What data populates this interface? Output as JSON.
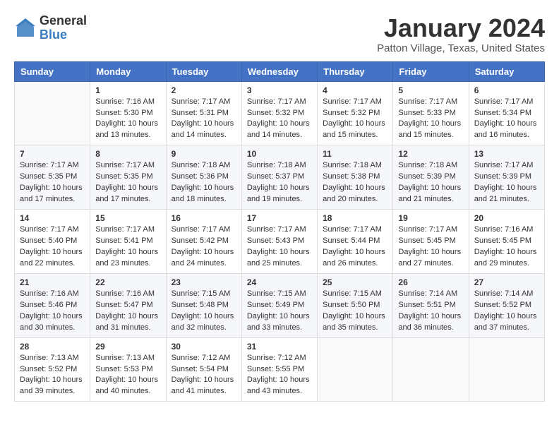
{
  "header": {
    "logo_general": "General",
    "logo_blue": "Blue",
    "month_title": "January 2024",
    "location": "Patton Village, Texas, United States"
  },
  "weekdays": [
    "Sunday",
    "Monday",
    "Tuesday",
    "Wednesday",
    "Thursday",
    "Friday",
    "Saturday"
  ],
  "weeks": [
    [
      {
        "day": "",
        "info": ""
      },
      {
        "day": "1",
        "info": "Sunrise: 7:16 AM\nSunset: 5:30 PM\nDaylight: 10 hours\nand 13 minutes."
      },
      {
        "day": "2",
        "info": "Sunrise: 7:17 AM\nSunset: 5:31 PM\nDaylight: 10 hours\nand 14 minutes."
      },
      {
        "day": "3",
        "info": "Sunrise: 7:17 AM\nSunset: 5:32 PM\nDaylight: 10 hours\nand 14 minutes."
      },
      {
        "day": "4",
        "info": "Sunrise: 7:17 AM\nSunset: 5:32 PM\nDaylight: 10 hours\nand 15 minutes."
      },
      {
        "day": "5",
        "info": "Sunrise: 7:17 AM\nSunset: 5:33 PM\nDaylight: 10 hours\nand 15 minutes."
      },
      {
        "day": "6",
        "info": "Sunrise: 7:17 AM\nSunset: 5:34 PM\nDaylight: 10 hours\nand 16 minutes."
      }
    ],
    [
      {
        "day": "7",
        "info": "Sunrise: 7:17 AM\nSunset: 5:35 PM\nDaylight: 10 hours\nand 17 minutes."
      },
      {
        "day": "8",
        "info": "Sunrise: 7:17 AM\nSunset: 5:35 PM\nDaylight: 10 hours\nand 17 minutes."
      },
      {
        "day": "9",
        "info": "Sunrise: 7:18 AM\nSunset: 5:36 PM\nDaylight: 10 hours\nand 18 minutes."
      },
      {
        "day": "10",
        "info": "Sunrise: 7:18 AM\nSunset: 5:37 PM\nDaylight: 10 hours\nand 19 minutes."
      },
      {
        "day": "11",
        "info": "Sunrise: 7:18 AM\nSunset: 5:38 PM\nDaylight: 10 hours\nand 20 minutes."
      },
      {
        "day": "12",
        "info": "Sunrise: 7:18 AM\nSunset: 5:39 PM\nDaylight: 10 hours\nand 21 minutes."
      },
      {
        "day": "13",
        "info": "Sunrise: 7:17 AM\nSunset: 5:39 PM\nDaylight: 10 hours\nand 21 minutes."
      }
    ],
    [
      {
        "day": "14",
        "info": "Sunrise: 7:17 AM\nSunset: 5:40 PM\nDaylight: 10 hours\nand 22 minutes."
      },
      {
        "day": "15",
        "info": "Sunrise: 7:17 AM\nSunset: 5:41 PM\nDaylight: 10 hours\nand 23 minutes."
      },
      {
        "day": "16",
        "info": "Sunrise: 7:17 AM\nSunset: 5:42 PM\nDaylight: 10 hours\nand 24 minutes."
      },
      {
        "day": "17",
        "info": "Sunrise: 7:17 AM\nSunset: 5:43 PM\nDaylight: 10 hours\nand 25 minutes."
      },
      {
        "day": "18",
        "info": "Sunrise: 7:17 AM\nSunset: 5:44 PM\nDaylight: 10 hours\nand 26 minutes."
      },
      {
        "day": "19",
        "info": "Sunrise: 7:17 AM\nSunset: 5:45 PM\nDaylight: 10 hours\nand 27 minutes."
      },
      {
        "day": "20",
        "info": "Sunrise: 7:16 AM\nSunset: 5:45 PM\nDaylight: 10 hours\nand 29 minutes."
      }
    ],
    [
      {
        "day": "21",
        "info": "Sunrise: 7:16 AM\nSunset: 5:46 PM\nDaylight: 10 hours\nand 30 minutes."
      },
      {
        "day": "22",
        "info": "Sunrise: 7:16 AM\nSunset: 5:47 PM\nDaylight: 10 hours\nand 31 minutes."
      },
      {
        "day": "23",
        "info": "Sunrise: 7:15 AM\nSunset: 5:48 PM\nDaylight: 10 hours\nand 32 minutes."
      },
      {
        "day": "24",
        "info": "Sunrise: 7:15 AM\nSunset: 5:49 PM\nDaylight: 10 hours\nand 33 minutes."
      },
      {
        "day": "25",
        "info": "Sunrise: 7:15 AM\nSunset: 5:50 PM\nDaylight: 10 hours\nand 35 minutes."
      },
      {
        "day": "26",
        "info": "Sunrise: 7:14 AM\nSunset: 5:51 PM\nDaylight: 10 hours\nand 36 minutes."
      },
      {
        "day": "27",
        "info": "Sunrise: 7:14 AM\nSunset: 5:52 PM\nDaylight: 10 hours\nand 37 minutes."
      }
    ],
    [
      {
        "day": "28",
        "info": "Sunrise: 7:13 AM\nSunset: 5:52 PM\nDaylight: 10 hours\nand 39 minutes."
      },
      {
        "day": "29",
        "info": "Sunrise: 7:13 AM\nSunset: 5:53 PM\nDaylight: 10 hours\nand 40 minutes."
      },
      {
        "day": "30",
        "info": "Sunrise: 7:12 AM\nSunset: 5:54 PM\nDaylight: 10 hours\nand 41 minutes."
      },
      {
        "day": "31",
        "info": "Sunrise: 7:12 AM\nSunset: 5:55 PM\nDaylight: 10 hours\nand 43 minutes."
      },
      {
        "day": "",
        "info": ""
      },
      {
        "day": "",
        "info": ""
      },
      {
        "day": "",
        "info": ""
      }
    ]
  ]
}
